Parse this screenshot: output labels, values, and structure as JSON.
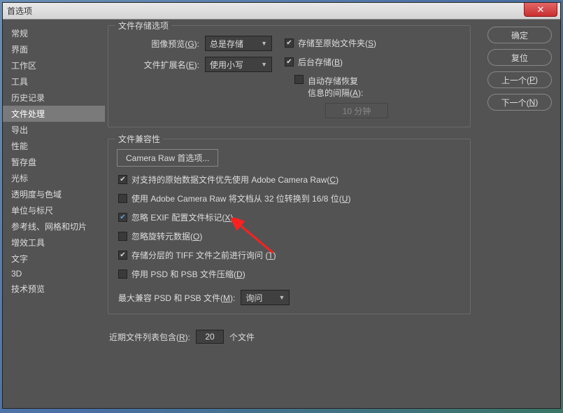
{
  "window": {
    "title": "首选项"
  },
  "sidebar": {
    "items": [
      {
        "label": "常规"
      },
      {
        "label": "界面"
      },
      {
        "label": "工作区"
      },
      {
        "label": "工具"
      },
      {
        "label": "历史记录"
      },
      {
        "label": "文件处理",
        "selected": true
      },
      {
        "label": "导出"
      },
      {
        "label": "性能"
      },
      {
        "label": "暂存盘"
      },
      {
        "label": "光标"
      },
      {
        "label": "透明度与色域"
      },
      {
        "label": "单位与标尺"
      },
      {
        "label": "参考线、网格和切片"
      },
      {
        "label": "增效工具"
      },
      {
        "label": "文字"
      },
      {
        "label": "3D"
      },
      {
        "label": "技术预览"
      }
    ]
  },
  "buttons": {
    "ok": "确定",
    "cancel": "复位",
    "prev_a": "上一个(",
    "prev_b": ")",
    "prev_key": "P",
    "next_a": "下一个(",
    "next_b": ")",
    "next_key": "N"
  },
  "save_section": {
    "legend": "文件存储选项",
    "preview_a": "图像预览(",
    "preview_b": "):",
    "preview_key": "G",
    "preview_val": "总是存储",
    "ext_a": "文件扩展名(",
    "ext_b": "):",
    "ext_key": "E",
    "ext_val": "使用小写",
    "orig_a": "存储至原始文件夹(",
    "orig_b": ")",
    "orig_key": "S",
    "bg_a": "后台存储(",
    "bg_b": ")",
    "bg_key": "B",
    "auto_l1": "自动存储恢复",
    "auto_l2_a": "信息的间隔(",
    "auto_l2_b": "):",
    "auto_key": "A",
    "auto_val": "10 分钟"
  },
  "compat": {
    "legend": "文件兼容性",
    "camera_btn": "Camera Raw 首选项...",
    "r1_a": "对支持的原始数据文件优先使用 Adobe Camera Raw(",
    "r1_b": ")",
    "r1_key": "C",
    "r2_a": "使用 Adobe Camera Raw 将文档从 32 位转换到 16/8 位(",
    "r2_b": ")",
    "r2_key": "U",
    "r3_a": "忽略 EXIF 配置文件标记(",
    "r3_b": ")",
    "r3_key": "X",
    "r4_a": "忽略旋转元数据(",
    "r4_b": ")",
    "r4_key": "O",
    "r5_a": "存储分层的 TIFF 文件之前进行询问 (",
    "r5_b": ")",
    "r5_key": "T",
    "r6_a": "停用 PSD 和 PSB 文件压缩(",
    "r6_b": ")",
    "r6_key": "D",
    "max_a": "最大兼容 PSD 和 PSB 文件(",
    "max_b": "):",
    "max_key": "M",
    "max_val": "询问"
  },
  "recent": {
    "label_a": "近期文件列表包含(",
    "label_b": "):",
    "key": "R",
    "value": "20",
    "suffix": "个文件"
  }
}
